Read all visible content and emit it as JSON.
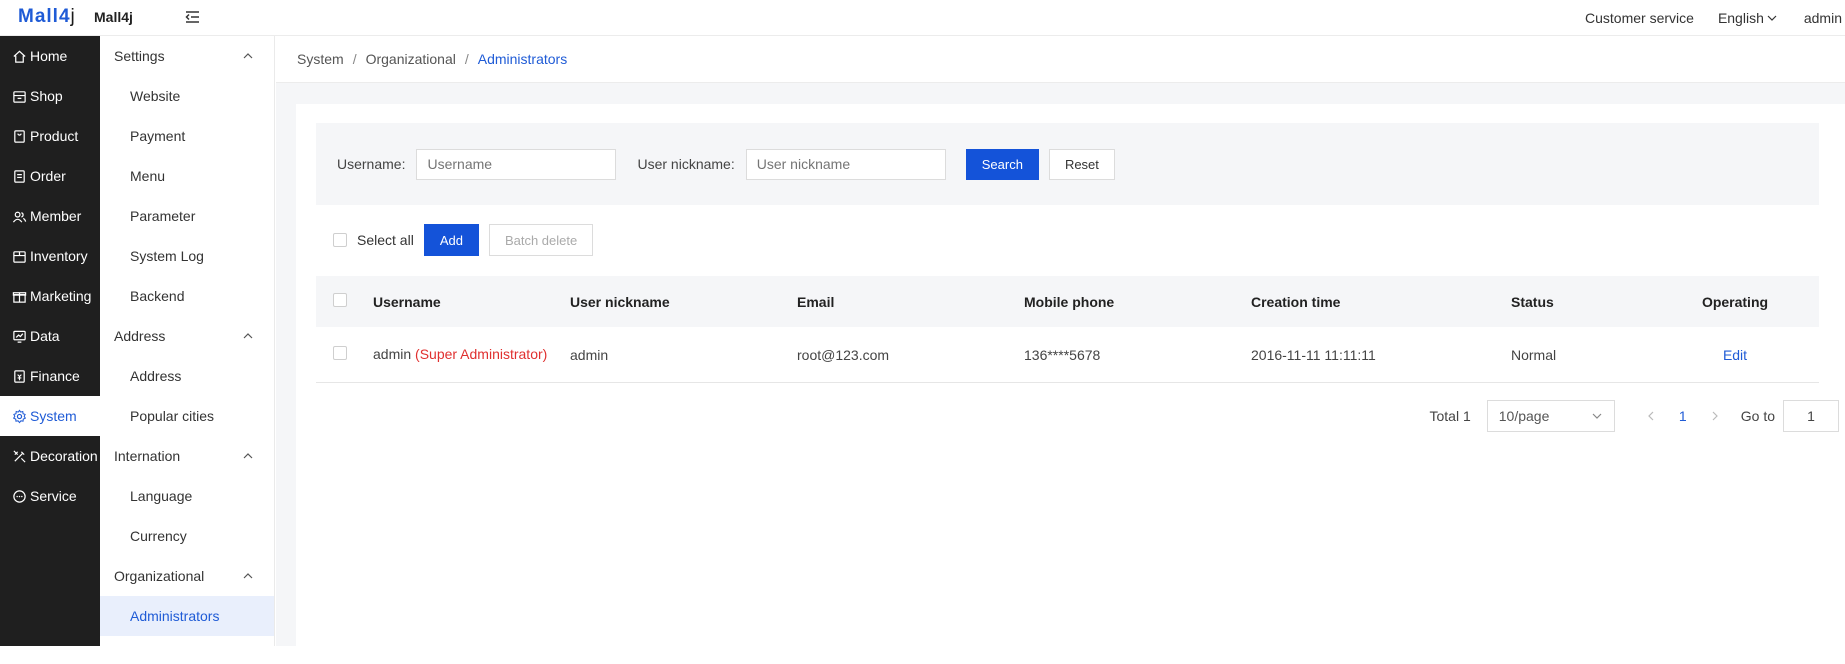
{
  "header": {
    "logo_text_a": "Mall",
    "logo_text_b": "4",
    "logo_text_c": "j",
    "app_name": "Mall4j",
    "customer_service": "Customer service",
    "language": "English",
    "user": "admin"
  },
  "rail": {
    "items": [
      {
        "label": "Home",
        "icon": "home-icon"
      },
      {
        "label": "Shop",
        "icon": "shop-icon"
      },
      {
        "label": "Product",
        "icon": "product-icon"
      },
      {
        "label": "Order",
        "icon": "order-icon"
      },
      {
        "label": "Member",
        "icon": "member-icon"
      },
      {
        "label": "Inventory",
        "icon": "inventory-icon"
      },
      {
        "label": "Marketing",
        "icon": "marketing-icon"
      },
      {
        "label": "Data",
        "icon": "data-icon"
      },
      {
        "label": "Finance",
        "icon": "finance-icon"
      },
      {
        "label": "System",
        "icon": "gear-icon",
        "active": true
      },
      {
        "label": "Decoration",
        "icon": "decoration-icon"
      },
      {
        "label": "Service",
        "icon": "service-icon"
      }
    ]
  },
  "submenu": {
    "groups": [
      {
        "label": "Settings",
        "items": [
          "Website",
          "Payment",
          "Menu",
          "Parameter",
          "System Log",
          "Backend"
        ]
      },
      {
        "label": "Address",
        "items": [
          "Address",
          "Popular cities"
        ]
      },
      {
        "label": "Internation",
        "items": [
          "Language",
          "Currency"
        ]
      },
      {
        "label": "Organizational",
        "items": [
          "Administrators"
        ]
      }
    ],
    "active_item": "Administrators"
  },
  "breadcrumb": [
    "System",
    "Organizational",
    "Administrators"
  ],
  "search": {
    "username_label": "Username:",
    "username_placeholder": "Username",
    "nickname_label": "User nickname:",
    "nickname_placeholder": "User nickname",
    "search_button": "Search",
    "reset_button": "Reset"
  },
  "toolbar": {
    "select_all": "Select all",
    "add_button": "Add",
    "batch_delete_button": "Batch delete"
  },
  "table": {
    "columns": [
      "Username",
      "User nickname",
      "Email",
      "Mobile phone",
      "Creation time",
      "Status",
      "Operating"
    ],
    "rows": [
      {
        "username": "admin",
        "username_tag": "(Super Administrator)",
        "nickname": "admin",
        "email": "root@123.com",
        "mobile": "136****5678",
        "created": "2016-11-11 11:11:11",
        "status": "Normal",
        "action": "Edit"
      }
    ]
  },
  "pagination": {
    "total": "Total 1",
    "page_size": "10/page",
    "current_page": "1",
    "goto_label": "Go to",
    "goto_value": "1"
  }
}
